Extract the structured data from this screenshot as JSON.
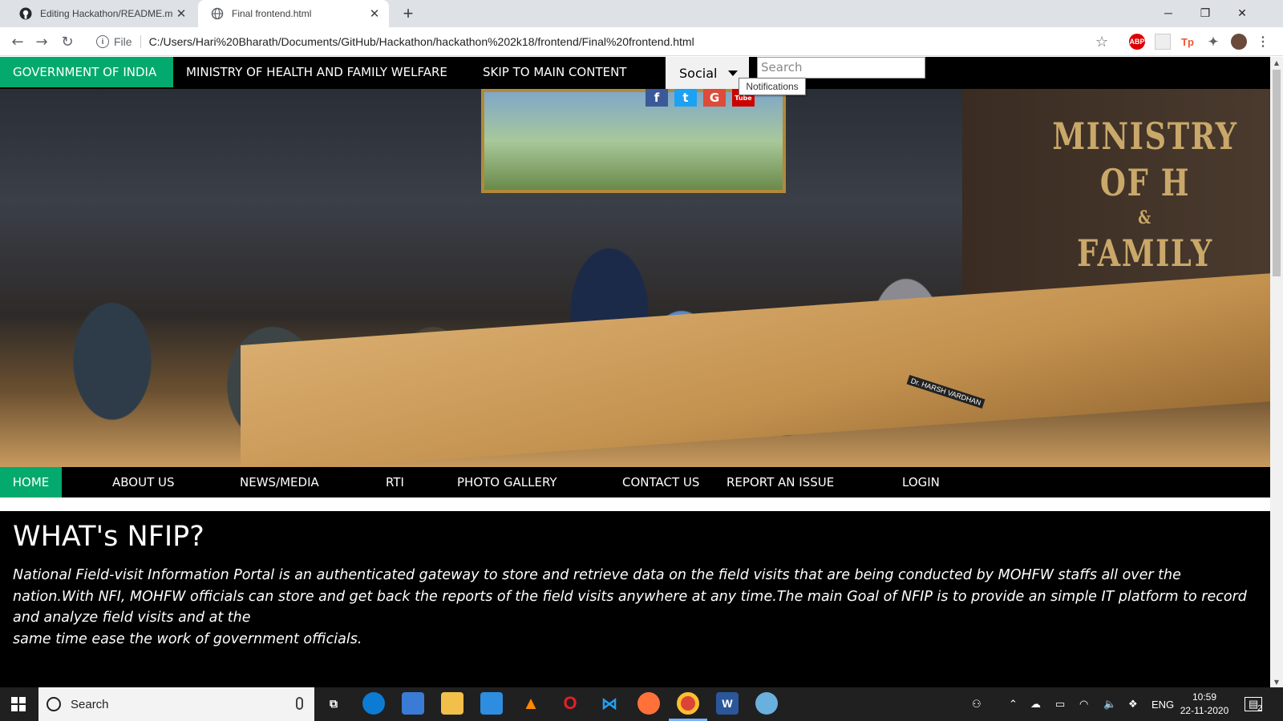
{
  "browser": {
    "tabs": [
      {
        "title": "Editing Hackathon/README.md a",
        "active": false,
        "icon": "github-icon"
      },
      {
        "title": "Final frontend.html",
        "active": true,
        "icon": "globe-icon"
      }
    ],
    "new_tab": "+",
    "address": {
      "scheme_label": "File",
      "url": "C:/Users/Hari%20Bharath/Documents/GitHub/Hackathon/hackathon%202k18/frontend/Final%20frontend.html"
    },
    "extensions": [
      "ABP",
      "Tp"
    ]
  },
  "page": {
    "topnav": {
      "gov": "GOVERNMENT OF INDIA",
      "ministry": "MINISTRY OF HEALTH AND FAMILY WELFARE",
      "skip": "SKIP TO MAIN CONTENT",
      "social": "Social",
      "search_placeholder": "Search",
      "tooltip": "Notifications"
    },
    "social_icons": [
      {
        "name": "facebook-icon",
        "glyph": "f",
        "color": "#3b5998"
      },
      {
        "name": "twitter-icon",
        "glyph": "t",
        "color": "#1da1f2"
      },
      {
        "name": "google-icon",
        "glyph": "G",
        "color": "#dd4b39"
      },
      {
        "name": "youtube-icon",
        "glyph": "Tube",
        "color": "#cc0000"
      }
    ],
    "hero": {
      "sign_line1": "MINISTRY OF H",
      "sign_amp": "&",
      "sign_line2": "FAMILY WEL",
      "nameplate": "Dr. HARSH VARDHAN"
    },
    "mainnav": {
      "home": "HOME",
      "about": "ABOUT US",
      "news": "NEWS/MEDIA",
      "rti": "RTI",
      "gallery": "PHOTO GALLERY",
      "contact": "CONTACT US",
      "report": "REPORT AN ISSUE",
      "login": "LOGIN"
    },
    "content": {
      "heading": "WHAT's NFIP?",
      "para1": "National Field-visit Information Portal is an authenticated gateway to store and retrieve data on the field visits that are being conducted by MOHFW staffs all over the nation.With NFI, MOHFW officials can store and get back the reports of the field visits anywhere at any time.The main Goal of NFIP is to provide an simple IT platform to record and analyze field visits and at the",
      "para2": "same time ease the work of government officials."
    },
    "colors": {
      "accent": "#04aa6d",
      "nav_bg": "#000000"
    }
  },
  "taskbar": {
    "search_label": "Search",
    "lang": "ENG",
    "time": "10:59",
    "date": "22-11-2020",
    "notifications_count": "2"
  }
}
